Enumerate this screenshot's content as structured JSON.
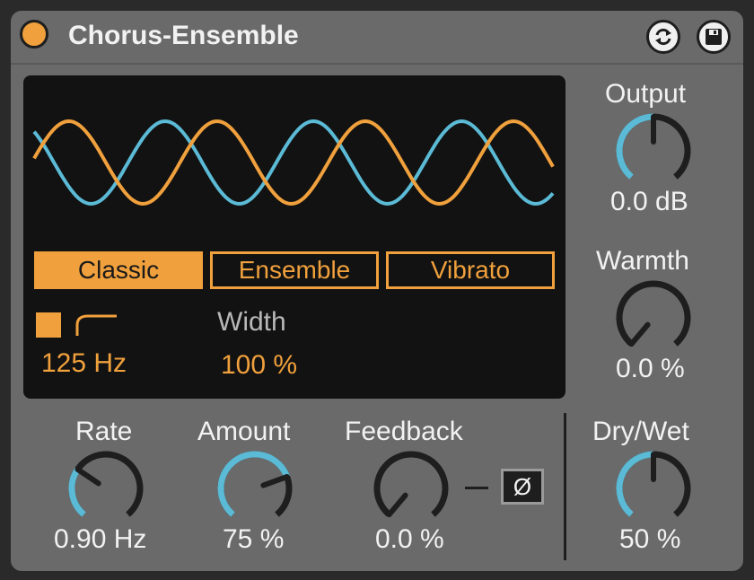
{
  "device": {
    "title": "Chorus-Ensemble",
    "power_on": true,
    "icons": [
      "power-icon",
      "hot-swap-icon",
      "save-preset-icon"
    ]
  },
  "display": {
    "modes": [
      {
        "label": "Classic",
        "active": true
      },
      {
        "label": "Ensemble",
        "active": false
      },
      {
        "label": "Vibrato",
        "active": false
      }
    ],
    "highpass": {
      "enabled": true,
      "value": "125 Hz"
    },
    "width": {
      "label": "Width",
      "value": "100 %"
    }
  },
  "knobs": {
    "output": {
      "label": "Output",
      "value": "0.0 dB",
      "fill": 0.5
    },
    "warmth": {
      "label": "Warmth",
      "value": "0.0 %",
      "fill": 0.0
    },
    "rate": {
      "label": "Rate",
      "value": "0.90 Hz",
      "fill": 0.3
    },
    "amount": {
      "label": "Amount",
      "value": "75 %",
      "fill": 0.75
    },
    "feedback": {
      "label": "Feedback",
      "value": "0.0 %",
      "fill": 0.0
    },
    "dry_wet": {
      "label": "Dry/Wet",
      "value": "50 %",
      "fill": 0.5
    }
  },
  "feedback_invert": {
    "label": "Ø",
    "active": false
  },
  "colors": {
    "accent": "#f0a03c",
    "blue": "#5bbad5",
    "panel": "#6a6a6a",
    "display_bg": "#121212"
  }
}
